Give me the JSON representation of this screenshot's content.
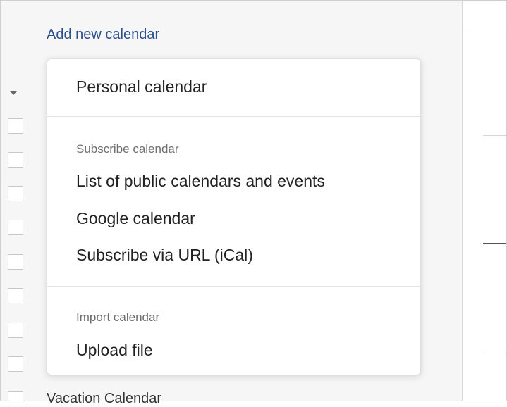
{
  "sidebar": {
    "add_calendar_label": "Add new calendar",
    "peek_calendar_label": "Vacation Calendar"
  },
  "dropdown": {
    "personal_item": "Personal calendar",
    "subscribe_section": {
      "header": "Subscribe calendar",
      "items": [
        "List of public calendars and events",
        "Google calendar",
        "Subscribe via URL (iCal)"
      ]
    },
    "import_section": {
      "header": "Import calendar",
      "items": [
        "Upload file"
      ]
    }
  },
  "colors": {
    "link": "#2b4f8c",
    "sidebar_bg": "#f6f6f6",
    "menu_text": "#222222",
    "section_header": "#6e6e6e"
  }
}
